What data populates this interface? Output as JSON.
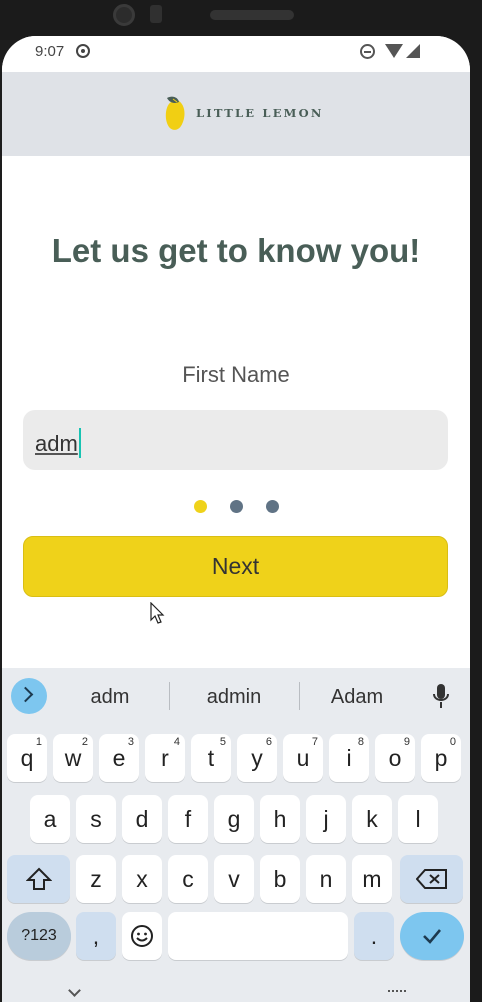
{
  "status_bar": {
    "time": "9:07",
    "icons": [
      "settings-gear-icon",
      "do-not-disturb-icon",
      "wifi-icon",
      "signal-icon"
    ]
  },
  "header": {
    "logo_text": "LITTLE LEMON",
    "logo_icon": "lemon-icon"
  },
  "onboarding": {
    "title": "Let us get to know you!",
    "field_label": "First Name",
    "field_value": "adm",
    "page_indicator": {
      "current": 1,
      "total": 3
    },
    "next_label": "Next"
  },
  "keyboard": {
    "suggestions": [
      "adm",
      "admin",
      "Adam"
    ],
    "rows": [
      [
        {
          "k": "q",
          "h": "1"
        },
        {
          "k": "w",
          "h": "2"
        },
        {
          "k": "e",
          "h": "3"
        },
        {
          "k": "r",
          "h": "4"
        },
        {
          "k": "t",
          "h": "5"
        },
        {
          "k": "y",
          "h": "6"
        },
        {
          "k": "u",
          "h": "7"
        },
        {
          "k": "i",
          "h": "8"
        },
        {
          "k": "o",
          "h": "9"
        },
        {
          "k": "p",
          "h": "0"
        }
      ],
      [
        {
          "k": "a"
        },
        {
          "k": "s"
        },
        {
          "k": "d"
        },
        {
          "k": "f"
        },
        {
          "k": "g"
        },
        {
          "k": "h"
        },
        {
          "k": "j"
        },
        {
          "k": "k"
        },
        {
          "k": "l"
        }
      ],
      [
        {
          "k": "z"
        },
        {
          "k": "x"
        },
        {
          "k": "c"
        },
        {
          "k": "v"
        },
        {
          "k": "b"
        },
        {
          "k": "n"
        },
        {
          "k": "m"
        }
      ]
    ],
    "symbols_label": "?123",
    "comma_label": ",",
    "period_label": "."
  },
  "colors": {
    "accent_yellow": "#efd21a",
    "brand_green": "#495e57",
    "dot_inactive": "#607385",
    "header_bg": "#dfe2e7"
  }
}
